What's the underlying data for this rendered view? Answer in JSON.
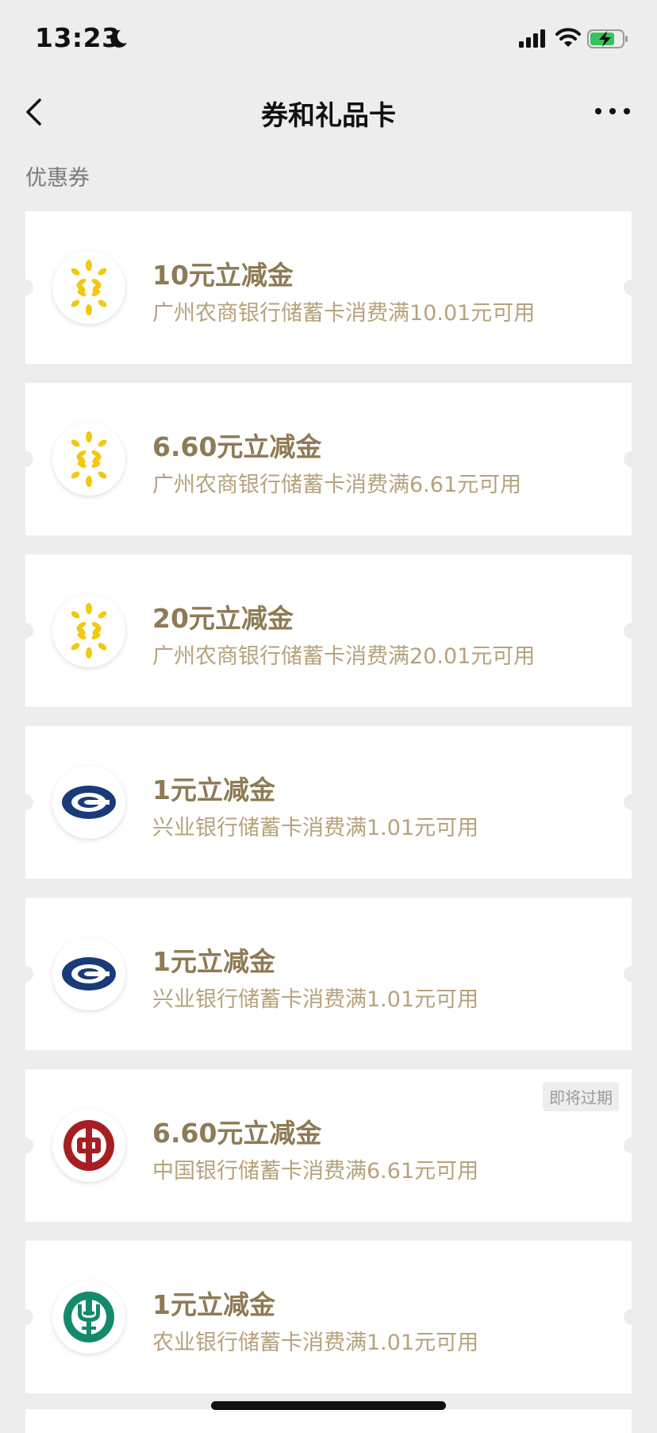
{
  "status_bar": {
    "time": "13:23"
  },
  "nav": {
    "title": "券和礼品卡"
  },
  "section": {
    "label": "优惠券"
  },
  "coupons": [
    {
      "bank_icon": "grcb-logo-icon",
      "title": "10元立减金",
      "desc": "广州农商银行储蓄卡消费满10.01元可用",
      "badge": ""
    },
    {
      "bank_icon": "grcb-logo-icon",
      "title": "6.60元立减金",
      "desc": "广州农商银行储蓄卡消费满6.61元可用",
      "badge": ""
    },
    {
      "bank_icon": "grcb-logo-icon",
      "title": "20元立减金",
      "desc": "广州农商银行储蓄卡消费满20.01元可用",
      "badge": ""
    },
    {
      "bank_icon": "cib-logo-icon",
      "title": "1元立减金",
      "desc": "兴业银行储蓄卡消费满1.01元可用",
      "badge": ""
    },
    {
      "bank_icon": "cib-logo-icon",
      "title": "1元立减金",
      "desc": "兴业银行储蓄卡消费满1.01元可用",
      "badge": ""
    },
    {
      "bank_icon": "boc-logo-icon",
      "title": "6.60元立减金",
      "desc": "中国银行储蓄卡消费满6.61元可用",
      "badge": "即将过期"
    },
    {
      "bank_icon": "abc-logo-icon",
      "title": "1元立减金",
      "desc": "农业银行储蓄卡消费满1.01元可用",
      "badge": ""
    }
  ],
  "colors": {
    "background": "#ededed",
    "title_gold": "#8e7a55",
    "desc_gold": "#b7a27c",
    "grcb_yellow": "#f2c811",
    "cib_navy": "#1b3a7a",
    "boc_red": "#a71e22",
    "abc_green": "#138a6b"
  }
}
